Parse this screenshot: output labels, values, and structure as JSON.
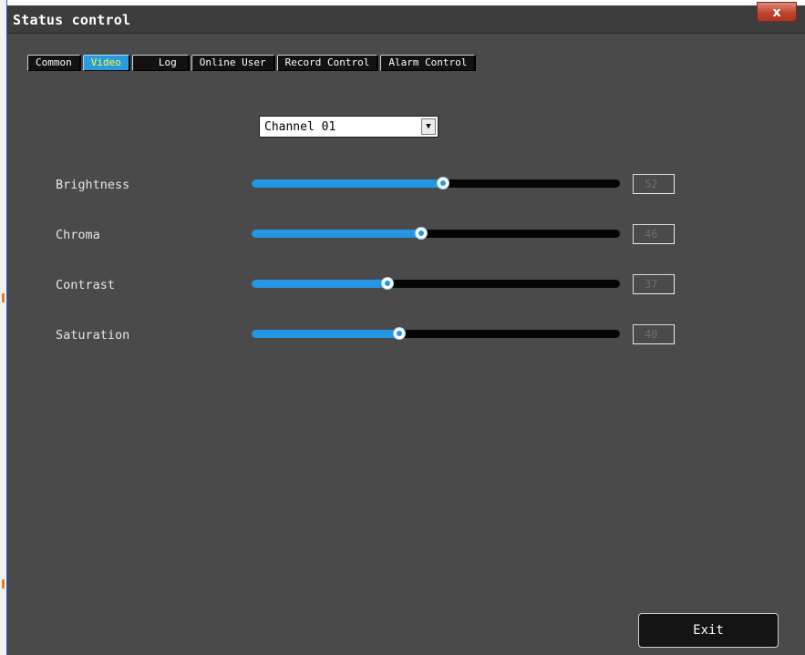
{
  "window": {
    "title": "Status control",
    "close_label": "x"
  },
  "tabs": [
    {
      "label": "Common",
      "active": false
    },
    {
      "label": "Video",
      "active": true
    },
    {
      "label": "Log",
      "active": false
    },
    {
      "label": "Online User",
      "active": false
    },
    {
      "label": "Record Control",
      "active": false
    },
    {
      "label": "Alarm Control",
      "active": false
    }
  ],
  "channel_select": {
    "value": "Channel 01",
    "icon": "chevron-down-icon"
  },
  "sliders": [
    {
      "label": "Brightness",
      "value": 52,
      "max": 100
    },
    {
      "label": "Chroma",
      "value": 46,
      "max": 100
    },
    {
      "label": "Contrast",
      "value": 37,
      "max": 100
    },
    {
      "label": "Saturation",
      "value": 40,
      "max": 100
    }
  ],
  "footer": {
    "exit_label": "Exit"
  },
  "colors": {
    "panel_bg": "#4a4a4a",
    "accent": "#2596e3",
    "active_tab_text": "#ffff33",
    "track": "#050505"
  }
}
